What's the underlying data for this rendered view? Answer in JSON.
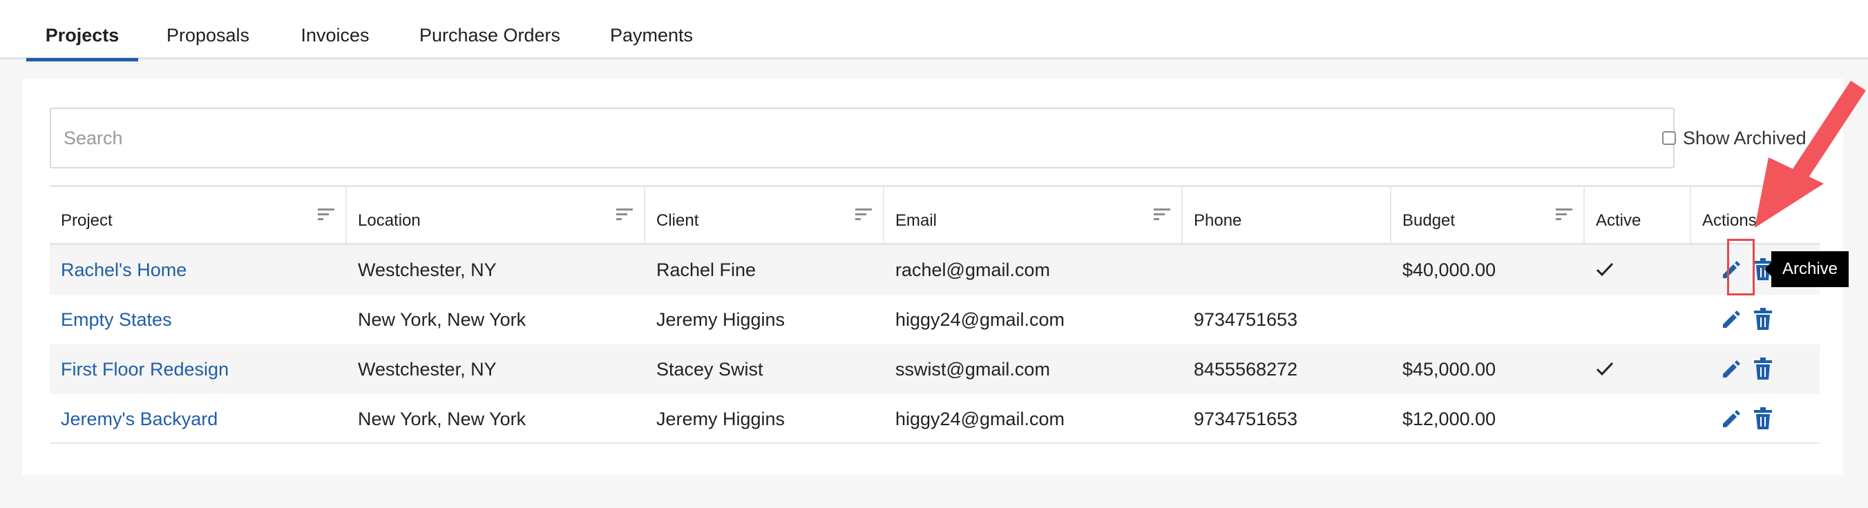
{
  "tabs": [
    {
      "label": "Projects",
      "active": true
    },
    {
      "label": "Proposals",
      "active": false
    },
    {
      "label": "Invoices",
      "active": false
    },
    {
      "label": "Purchase Orders",
      "active": false
    },
    {
      "label": "Payments",
      "active": false
    }
  ],
  "search": {
    "placeholder": "Search",
    "value": ""
  },
  "show_archived": {
    "label": "Show Archived",
    "checked": false
  },
  "table": {
    "columns": [
      "Project",
      "Location",
      "Client",
      "Email",
      "Phone",
      "Budget",
      "Active",
      "Actions"
    ],
    "sortable_columns": [
      "Project",
      "Location",
      "Client",
      "Email",
      "Budget"
    ],
    "rows": [
      {
        "project": "Rachel's Home",
        "location": "Westchester, NY",
        "client": "Rachel Fine",
        "email": "rachel@gmail.com",
        "phone": "",
        "budget": "$40,000.00",
        "active": true
      },
      {
        "project": "Empty States",
        "location": "New York, New York",
        "client": "Jeremy Higgins",
        "email": "higgy24@gmail.com",
        "phone": "9734751653",
        "budget": "",
        "active": false
      },
      {
        "project": "First Floor Redesign",
        "location": "Westchester, NY",
        "client": "Stacey Swist",
        "email": "sswist@gmail.com",
        "phone": "8455568272",
        "budget": "$45,000.00",
        "active": true
      },
      {
        "project": "Jeremy's Backyard",
        "location": "New York, New York",
        "client": "Jeremy Higgins",
        "email": "higgy24@gmail.com",
        "phone": "9734751653",
        "budget": "$12,000.00",
        "active": false
      }
    ]
  },
  "tooltip": {
    "label": "Archive"
  },
  "icons": {
    "sort": "sort-icon",
    "edit": "pencil-icon",
    "archive": "trash-icon",
    "active": "checkmark-icon"
  },
  "colors": {
    "accent": "#1f5ea8",
    "annotation": "#e8474d",
    "tooltip_bg": "#000000"
  }
}
